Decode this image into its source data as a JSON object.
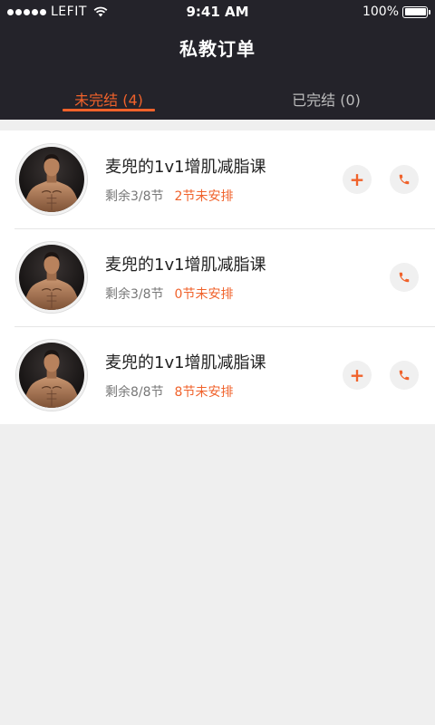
{
  "statusbar": {
    "carrier": "LEFIT",
    "time": "9:41 AM",
    "battery": "100%"
  },
  "header": {
    "title": "私教订单"
  },
  "tabs": [
    {
      "label": "未完结 (4)",
      "active": true
    },
    {
      "label": "已完结 (0)",
      "active": false
    }
  ],
  "orders": [
    {
      "title": "麦兜的1v1增肌减脂课",
      "remaining": "剩余3/8节",
      "unscheduled": "2节未安排",
      "show_add": true
    },
    {
      "title": "麦兜的1v1增肌减脂课",
      "remaining": "剩余3/8节",
      "unscheduled": "0节未安排",
      "show_add": false
    },
    {
      "title": "麦兜的1v1增肌减脂课",
      "remaining": "剩余8/8节",
      "unscheduled": "8节未安排",
      "show_add": true
    }
  ],
  "colors": {
    "accent": "#f0622b",
    "header_bg": "#24232a"
  },
  "icons": [
    "wifi-icon",
    "battery-icon",
    "add-icon",
    "phone-icon",
    "avatar"
  ]
}
